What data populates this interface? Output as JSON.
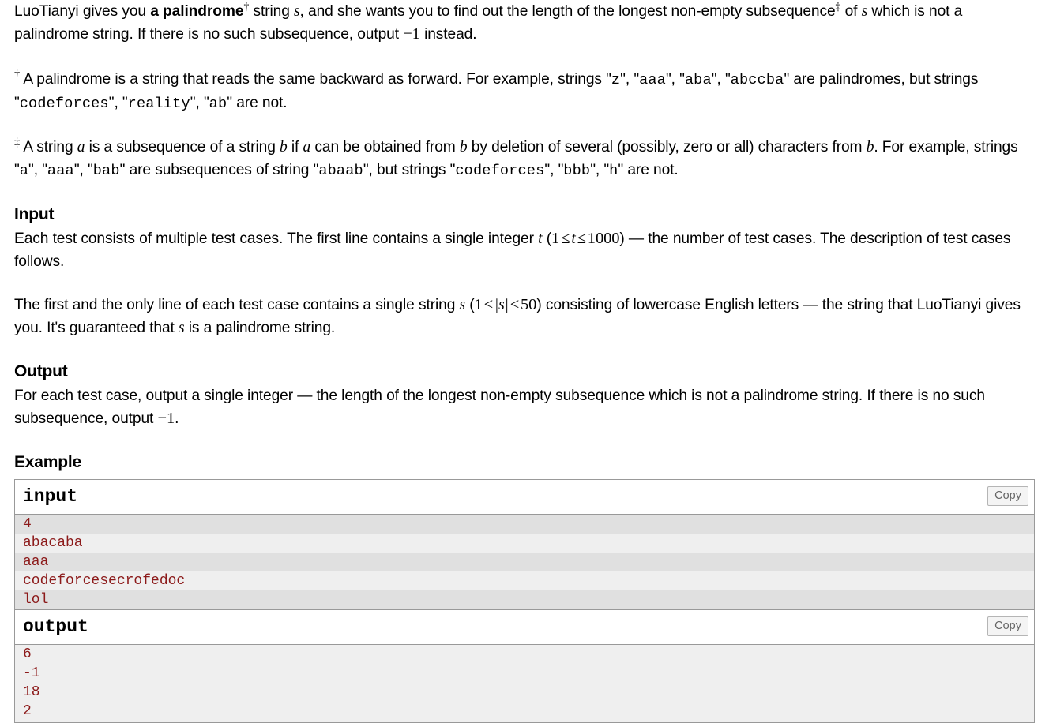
{
  "statement": {
    "main_paragraph": {
      "t1": "LuoTianyi gives you ",
      "bold": "a palindrome",
      "dagger": "†",
      "t2": " string ",
      "var_s1": "s",
      "t3": ", and she wants you to find out the length of the longest non-empty subsequence",
      "ddagger": "‡",
      "t4": " of ",
      "var_s2": "s",
      "t5": " which is not a palindrome string. If there is no such subsequence, output ",
      "minus_one": "−1",
      "t6": " instead."
    },
    "footnote_dagger": {
      "mark": "†",
      "t1": " A palindrome is a string that reads the same backward as forward. For example, strings \"",
      "c1": "z",
      "t2": "\", \"",
      "c2": "aaa",
      "t3": "\", \"",
      "c3": "aba",
      "t4": "\", \"",
      "c4": "abccba",
      "t5": "\" are palindromes, but strings \"",
      "c5": "codeforces",
      "t6": "\", \"",
      "c6": "reality",
      "t7": "\", \"",
      "c7": "ab",
      "t8": "\" are not."
    },
    "footnote_ddagger": {
      "mark": "‡",
      "t1": " A string ",
      "a1": "a",
      "t2": " is a subsequence of a string ",
      "b1": "b",
      "t3": " if ",
      "a2": "a",
      "t4": " can be obtained from ",
      "b2": "b",
      "t5": " by deletion of several (possibly, zero or all) characters from ",
      "b3": "b",
      "t6": ". For example, strings \"",
      "c1": "a",
      "t7": "\", \"",
      "c2": "aaa",
      "t8": "\", \"",
      "c3": "bab",
      "t9": "\" are subsequences of string \"",
      "c4": "abaab",
      "t10": "\", but strings \"",
      "c5": "codeforces",
      "t11": "\", \"",
      "c6": "bbb",
      "t12": "\", \"",
      "c7": "h",
      "t13": "\" are not."
    }
  },
  "input_section": {
    "heading": "Input",
    "p1": {
      "t1": "Each test consists of multiple test cases. The first line contains a single integer ",
      "var_t": "t",
      "t2": " (",
      "lo": "1",
      "le1": "≤",
      "var_t2": "t",
      "le2": "≤",
      "hi": "1000",
      "t3": ") — the number of test cases. The description of test cases follows."
    },
    "p2": {
      "t1": "The first and the only line of each test case contains a single string ",
      "var_s": "s",
      "t2": " (",
      "lo": "1",
      "le1": "≤",
      "abs_s": "|s|",
      "le2": "≤",
      "hi": "50",
      "t3": ") consisting of lowercase English letters — the string that LuoTianyi gives you. It's guaranteed that ",
      "var_s2": "s",
      "t4": " is a palindrome string."
    }
  },
  "output_section": {
    "heading": "Output",
    "p1": {
      "t1": "For each test case, output a single integer — the length of the longest non-empty subsequence which is not a palindrome string. If there is no such subsequence, output ",
      "minus_one": "−1",
      "t2": "."
    }
  },
  "example_section": {
    "heading": "Example",
    "copy_label": "Copy",
    "blocks": [
      {
        "title": "input",
        "lines": [
          "4",
          "abacaba",
          "aaa",
          "codeforcesecrofedoc",
          "lol"
        ],
        "striped": true
      },
      {
        "title": "output",
        "lines": [
          "6",
          "-1",
          "18",
          "2"
        ],
        "striped": false
      }
    ]
  },
  "colors": {
    "sample_text": "#8c1a1a",
    "stripe_dark": "#e0e0e0",
    "stripe_light": "#efefef",
    "border": "#999999",
    "copy_text": "#666666"
  }
}
